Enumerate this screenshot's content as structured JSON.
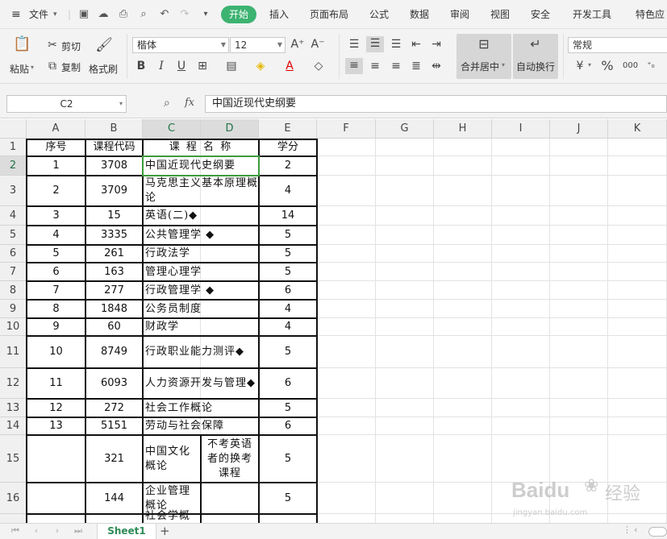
{
  "menubar": {
    "file_label": "文件",
    "tabs": [
      "开始",
      "插入",
      "页面布局",
      "公式",
      "数据",
      "审阅",
      "视图",
      "安全",
      "开发工具",
      "特色应"
    ]
  },
  "ribbon": {
    "paste": "粘贴",
    "cut": "剪切",
    "copy": "复制",
    "format_painter": "格式刷",
    "font_name": "楷体",
    "font_size": "12",
    "merge_center": "合并居中",
    "wrap_text": "自动换行",
    "number_format": "常规"
  },
  "formula_bar": {
    "name_box": "C2",
    "fx": "fx",
    "content": "中国近现代史纲要"
  },
  "columns": [
    "A",
    "B",
    "C",
    "D",
    "E",
    "F",
    "G",
    "H",
    "I",
    "J",
    "K"
  ],
  "rows": [
    "1",
    "2",
    "3",
    "4",
    "5",
    "6",
    "7",
    "8",
    "9",
    "10",
    "11",
    "12",
    "13",
    "14",
    "15",
    "16"
  ],
  "headers": {
    "seq": "序号",
    "code": "课程代码",
    "name": "课 程 名 称",
    "credit": "学分"
  },
  "table": [
    {
      "seq": "1",
      "code": "3708",
      "name": "中国近现代史纲要",
      "credit": "2"
    },
    {
      "seq": "2",
      "code": "3709",
      "name": "马克思主义基本原理概论",
      "credit": "4"
    },
    {
      "seq": "3",
      "code": "15",
      "name": "英语(二)◆",
      "credit": "14"
    },
    {
      "seq": "4",
      "code": "3335",
      "name": "公共管理学 ◆",
      "credit": "5"
    },
    {
      "seq": "5",
      "code": "261",
      "name": "行政法学",
      "credit": "5"
    },
    {
      "seq": "6",
      "code": "163",
      "name": "管理心理学",
      "credit": "5"
    },
    {
      "seq": "7",
      "code": "277",
      "name": "行政管理学   ◆",
      "credit": "6"
    },
    {
      "seq": "8",
      "code": "1848",
      "name": "公务员制度",
      "credit": "4"
    },
    {
      "seq": "9",
      "code": "60",
      "name": "财政学",
      "credit": "4"
    },
    {
      "seq": "10",
      "code": "8749",
      "name": "行政职业能力测评◆",
      "credit": "5"
    },
    {
      "seq": "11",
      "code": "6093",
      "name": "人力资源开发与管理◆",
      "credit": "6"
    },
    {
      "seq": "12",
      "code": "272",
      "name": "社会工作概论",
      "credit": "5"
    },
    {
      "seq": "13",
      "code": "5151",
      "name": "劳动与社会保障",
      "credit": "6"
    }
  ],
  "extra_rows": [
    {
      "code": "321",
      "name": "中国文化概论",
      "note": "不考英语者的换考课程",
      "credit": "5"
    },
    {
      "code": "144",
      "name": "企业管理概论",
      "credit": "5"
    }
  ],
  "partial_row": "社会学概",
  "sheet_tab": "Sheet1",
  "watermark": {
    "brand": "Baidu",
    "sub": "经验",
    "url": "jingyan.baidu.com"
  }
}
